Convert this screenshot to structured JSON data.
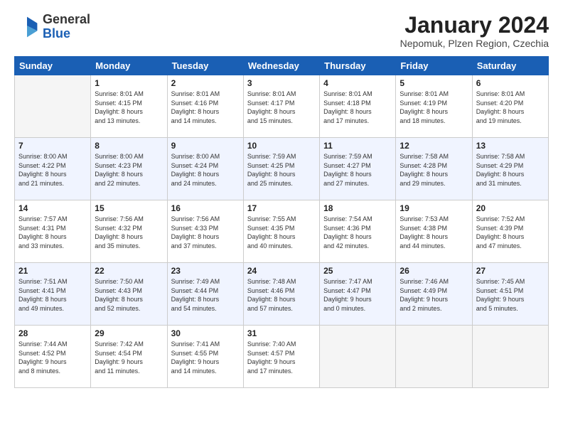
{
  "header": {
    "logo_line1": "General",
    "logo_line2": "Blue",
    "month_title": "January 2024",
    "subtitle": "Nepomuk, Plzen Region, Czechia"
  },
  "weekdays": [
    "Sunday",
    "Monday",
    "Tuesday",
    "Wednesday",
    "Thursday",
    "Friday",
    "Saturday"
  ],
  "weeks": [
    [
      {
        "day": null,
        "info": null
      },
      {
        "day": "1",
        "info": "Sunrise: 8:01 AM\nSunset: 4:15 PM\nDaylight: 8 hours\nand 13 minutes."
      },
      {
        "day": "2",
        "info": "Sunrise: 8:01 AM\nSunset: 4:16 PM\nDaylight: 8 hours\nand 14 minutes."
      },
      {
        "day": "3",
        "info": "Sunrise: 8:01 AM\nSunset: 4:17 PM\nDaylight: 8 hours\nand 15 minutes."
      },
      {
        "day": "4",
        "info": "Sunrise: 8:01 AM\nSunset: 4:18 PM\nDaylight: 8 hours\nand 17 minutes."
      },
      {
        "day": "5",
        "info": "Sunrise: 8:01 AM\nSunset: 4:19 PM\nDaylight: 8 hours\nand 18 minutes."
      },
      {
        "day": "6",
        "info": "Sunrise: 8:01 AM\nSunset: 4:20 PM\nDaylight: 8 hours\nand 19 minutes."
      }
    ],
    [
      {
        "day": "7",
        "info": "Sunrise: 8:00 AM\nSunset: 4:22 PM\nDaylight: 8 hours\nand 21 minutes."
      },
      {
        "day": "8",
        "info": "Sunrise: 8:00 AM\nSunset: 4:23 PM\nDaylight: 8 hours\nand 22 minutes."
      },
      {
        "day": "9",
        "info": "Sunrise: 8:00 AM\nSunset: 4:24 PM\nDaylight: 8 hours\nand 24 minutes."
      },
      {
        "day": "10",
        "info": "Sunrise: 7:59 AM\nSunset: 4:25 PM\nDaylight: 8 hours\nand 25 minutes."
      },
      {
        "day": "11",
        "info": "Sunrise: 7:59 AM\nSunset: 4:27 PM\nDaylight: 8 hours\nand 27 minutes."
      },
      {
        "day": "12",
        "info": "Sunrise: 7:58 AM\nSunset: 4:28 PM\nDaylight: 8 hours\nand 29 minutes."
      },
      {
        "day": "13",
        "info": "Sunrise: 7:58 AM\nSunset: 4:29 PM\nDaylight: 8 hours\nand 31 minutes."
      }
    ],
    [
      {
        "day": "14",
        "info": "Sunrise: 7:57 AM\nSunset: 4:31 PM\nDaylight: 8 hours\nand 33 minutes."
      },
      {
        "day": "15",
        "info": "Sunrise: 7:56 AM\nSunset: 4:32 PM\nDaylight: 8 hours\nand 35 minutes."
      },
      {
        "day": "16",
        "info": "Sunrise: 7:56 AM\nSunset: 4:33 PM\nDaylight: 8 hours\nand 37 minutes."
      },
      {
        "day": "17",
        "info": "Sunrise: 7:55 AM\nSunset: 4:35 PM\nDaylight: 8 hours\nand 40 minutes."
      },
      {
        "day": "18",
        "info": "Sunrise: 7:54 AM\nSunset: 4:36 PM\nDaylight: 8 hours\nand 42 minutes."
      },
      {
        "day": "19",
        "info": "Sunrise: 7:53 AM\nSunset: 4:38 PM\nDaylight: 8 hours\nand 44 minutes."
      },
      {
        "day": "20",
        "info": "Sunrise: 7:52 AM\nSunset: 4:39 PM\nDaylight: 8 hours\nand 47 minutes."
      }
    ],
    [
      {
        "day": "21",
        "info": "Sunrise: 7:51 AM\nSunset: 4:41 PM\nDaylight: 8 hours\nand 49 minutes."
      },
      {
        "day": "22",
        "info": "Sunrise: 7:50 AM\nSunset: 4:43 PM\nDaylight: 8 hours\nand 52 minutes."
      },
      {
        "day": "23",
        "info": "Sunrise: 7:49 AM\nSunset: 4:44 PM\nDaylight: 8 hours\nand 54 minutes."
      },
      {
        "day": "24",
        "info": "Sunrise: 7:48 AM\nSunset: 4:46 PM\nDaylight: 8 hours\nand 57 minutes."
      },
      {
        "day": "25",
        "info": "Sunrise: 7:47 AM\nSunset: 4:47 PM\nDaylight: 9 hours\nand 0 minutes."
      },
      {
        "day": "26",
        "info": "Sunrise: 7:46 AM\nSunset: 4:49 PM\nDaylight: 9 hours\nand 2 minutes."
      },
      {
        "day": "27",
        "info": "Sunrise: 7:45 AM\nSunset: 4:51 PM\nDaylight: 9 hours\nand 5 minutes."
      }
    ],
    [
      {
        "day": "28",
        "info": "Sunrise: 7:44 AM\nSunset: 4:52 PM\nDaylight: 9 hours\nand 8 minutes."
      },
      {
        "day": "29",
        "info": "Sunrise: 7:42 AM\nSunset: 4:54 PM\nDaylight: 9 hours\nand 11 minutes."
      },
      {
        "day": "30",
        "info": "Sunrise: 7:41 AM\nSunset: 4:55 PM\nDaylight: 9 hours\nand 14 minutes."
      },
      {
        "day": "31",
        "info": "Sunrise: 7:40 AM\nSunset: 4:57 PM\nDaylight: 9 hours\nand 17 minutes."
      },
      {
        "day": null,
        "info": null
      },
      {
        "day": null,
        "info": null
      },
      {
        "day": null,
        "info": null
      }
    ]
  ]
}
